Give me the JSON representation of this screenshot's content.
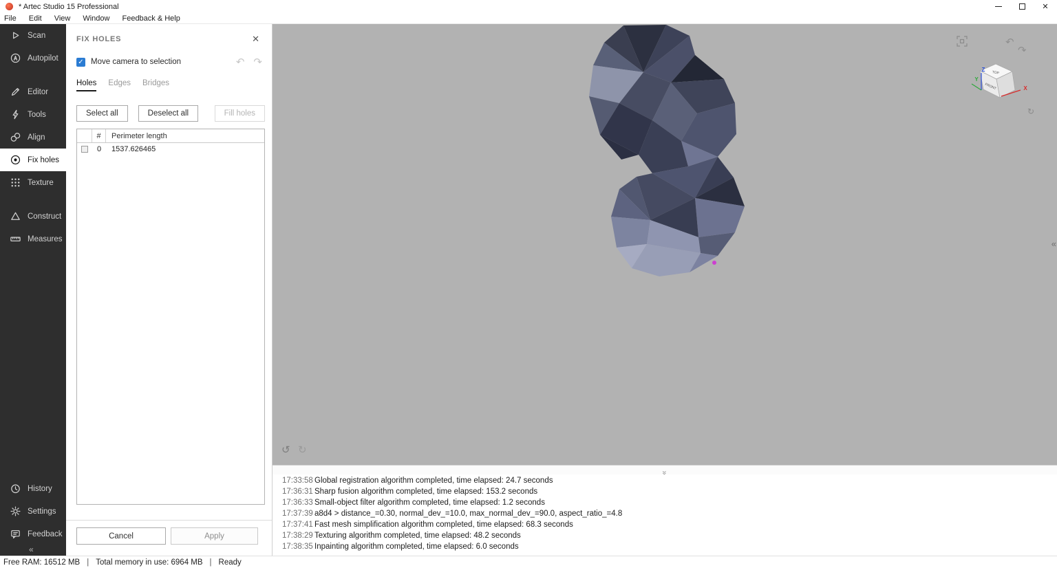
{
  "window": {
    "title": "* Artec Studio 15 Professional"
  },
  "menu": {
    "items": [
      "File",
      "Edit",
      "View",
      "Window",
      "Feedback & Help"
    ]
  },
  "sidebar": {
    "groups": [
      {
        "items": [
          {
            "label": "Scan"
          },
          {
            "label": "Autopilot"
          }
        ]
      },
      {
        "items": [
          {
            "label": "Editor"
          },
          {
            "label": "Tools"
          },
          {
            "label": "Align"
          },
          {
            "label": "Fix holes",
            "active": true
          },
          {
            "label": "Texture"
          }
        ]
      },
      {
        "items": [
          {
            "label": "Construct"
          },
          {
            "label": "Measures"
          }
        ]
      },
      {
        "items": [
          {
            "label": "History"
          },
          {
            "label": "Settings"
          },
          {
            "label": "Feedback"
          }
        ]
      }
    ]
  },
  "panel": {
    "title": "FIX HOLES",
    "move_camera": {
      "label": "Move camera to selection",
      "checked": true
    },
    "tabs": [
      {
        "label": "Holes",
        "active": true
      },
      {
        "label": "Edges"
      },
      {
        "label": "Bridges"
      }
    ],
    "actions": {
      "select_all": "Select all",
      "deselect_all": "Deselect all",
      "fill_holes": "Fill holes"
    },
    "table": {
      "columns": {
        "index": "#",
        "perimeter": "Perimeter length"
      },
      "rows": [
        {
          "index": "0",
          "perimeter": "1537.626465",
          "checked": false
        }
      ]
    },
    "footer": {
      "cancel": "Cancel",
      "apply": "Apply"
    }
  },
  "viewport": {
    "nav_cube": {
      "top_label": "TOP",
      "front_label": "FRONT",
      "axis_x": "X",
      "axis_y": "Y",
      "axis_z": "Z"
    }
  },
  "log": {
    "entries": [
      {
        "time": "17:33:58",
        "message": "Global registration algorithm completed, time elapsed: 24.7 seconds"
      },
      {
        "time": "17:36:31",
        "message": "Sharp fusion algorithm completed, time elapsed: 153.2 seconds"
      },
      {
        "time": "17:36:33",
        "message": "Small-object filter algorithm completed, time elapsed: 1.2 seconds"
      },
      {
        "time": "17:37:39",
        "message": "a8d4 > distance_=0.30, normal_dev_=10.0, max_normal_dev_=90.0, aspect_ratio_=4.8"
      },
      {
        "time": "17:37:41",
        "message": "Fast mesh simplification algorithm completed, time elapsed: 68.3 seconds"
      },
      {
        "time": "17:38:29",
        "message": "Texturing algorithm completed, time elapsed: 48.2 seconds"
      },
      {
        "time": "17:38:35",
        "message": "Inpainting algorithm completed, time elapsed: 6.0 seconds"
      }
    ]
  },
  "status_bar": {
    "free_ram": "Free RAM: 16512 MB",
    "separator": "|",
    "memory_in_use": "Total memory in use: 6964 MB",
    "ready": "Ready"
  },
  "colors": {
    "accent_blue": "#2b7cd3",
    "viewport_bg": "#b2b2b2",
    "sidebar_bg": "#2e2e2e",
    "selection_dot": "#cc3fd0",
    "axis_x_red": "#d92b2b",
    "axis_y_green": "#2fa83c",
    "axis_z_blue": "#2b50d9"
  },
  "icons": {
    "window_minimize": "–",
    "window_close": "✕",
    "panel_close": "✕",
    "undo": "↶",
    "redo": "↷",
    "view_back": "↶",
    "view_forward": "↷",
    "viewport_undo": "↺",
    "viewport_redo": "↻",
    "nav_extra": "↻",
    "check": "✓",
    "collapse_left": "«",
    "collapse_down": "«"
  }
}
